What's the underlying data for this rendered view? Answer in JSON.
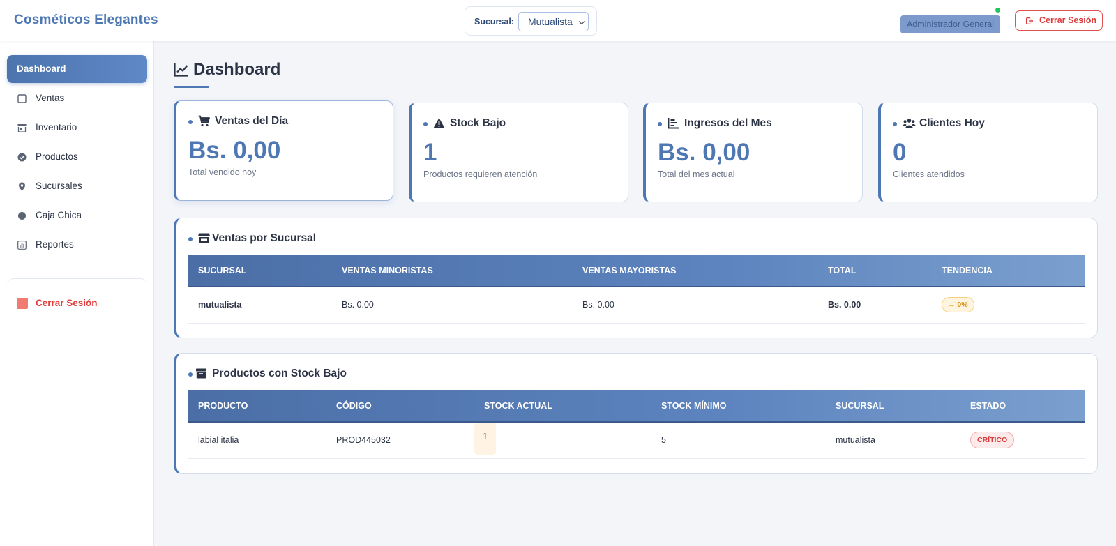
{
  "header": {
    "brand": "Cosméticos Elegantes",
    "branch_label": "Sucursal:",
    "branch_selected": "Mutualista",
    "user_role": "Administrador General",
    "logout_label": "Cerrar Sesión"
  },
  "sidebar": {
    "items": [
      {
        "label": "Dashboard",
        "icon": "dashboard",
        "active": true
      },
      {
        "label": "Ventas",
        "icon": "square-icon"
      },
      {
        "label": "Inventario",
        "icon": "store-icon"
      },
      {
        "label": "Productos",
        "icon": "check-circle-icon"
      },
      {
        "label": "Sucursales",
        "icon": "map-pin-icon"
      },
      {
        "label": "Caja Chica",
        "icon": "circle-icon"
      },
      {
        "label": "Reportes",
        "icon": "bar-chart-icon"
      }
    ],
    "logout_label": "Cerrar Sesión"
  },
  "main": {
    "title": "Dashboard",
    "cards": [
      {
        "title": "Ventas del Día",
        "value": "Bs. 0,00",
        "subtitle": "Total vendido hoy",
        "icon": "cart-icon"
      },
      {
        "title": "Stock Bajo",
        "value": "1",
        "subtitle": "Productos requieren atención",
        "icon": "warning-icon"
      },
      {
        "title": "Ingresos del Mes",
        "value": "Bs. 0,00",
        "subtitle": "Total del mes actual",
        "icon": "chart-icon"
      },
      {
        "title": "Clientes Hoy",
        "value": "0",
        "subtitle": "Clientes atendidos",
        "icon": "users-icon"
      }
    ],
    "sales_panel": {
      "title": "Ventas por Sucursal",
      "columns": [
        "Sucursal",
        "Ventas Minoristas",
        "Ventas Mayoristas",
        "Total",
        "Tendencia"
      ],
      "rows": [
        {
          "sucursal": "mutualista",
          "minoristas": "Bs. 0.00",
          "mayoristas": "Bs. 0.00",
          "total": "Bs. 0.00",
          "tendencia": "→ 0%"
        }
      ]
    },
    "stock_panel": {
      "title": "Productos con Stock Bajo",
      "columns": [
        "Producto",
        "Código",
        "Stock Actual",
        "Stock Mínimo",
        "Sucursal",
        "Estado"
      ],
      "rows": [
        {
          "producto": "labial italia",
          "codigo": "PROD445032",
          "stock_actual": "1",
          "stock_minimo": "5",
          "sucursal": "mutualista",
          "estado": "CRÍTICO"
        }
      ]
    }
  },
  "colors": {
    "accent": "#4d78b4",
    "danger": "#e23d3d",
    "online": "#22c55e",
    "warning": "#d88a0b"
  }
}
